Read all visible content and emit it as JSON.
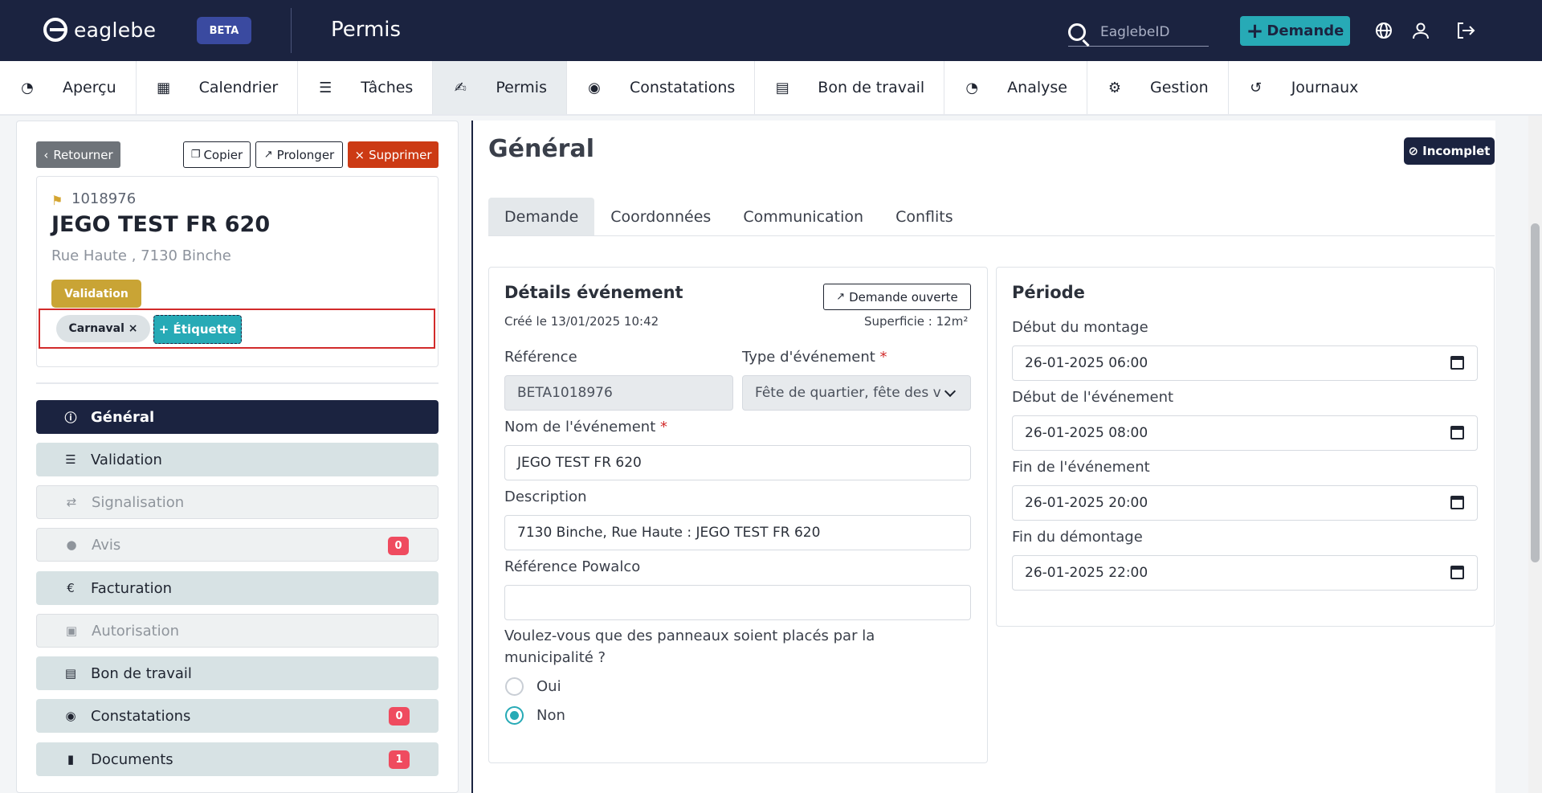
{
  "header": {
    "brand": "eaglebe",
    "beta_label": "BETA",
    "app_title": "Permis",
    "search_placeholder": "EaglebeID",
    "new_request_label": "Demande"
  },
  "nav": {
    "tabs": [
      {
        "label": "Aperçu",
        "icon": "gauge-icon"
      },
      {
        "label": "Calendrier",
        "icon": "calendar-icon"
      },
      {
        "label": "Tâches",
        "icon": "checklist-icon"
      },
      {
        "label": "Permis",
        "icon": "signature-icon",
        "active": true
      },
      {
        "label": "Constatations",
        "icon": "eye-icon"
      },
      {
        "label": "Bon de travail",
        "icon": "document-icon"
      },
      {
        "label": "Analyse",
        "icon": "gauge-icon"
      },
      {
        "label": "Gestion",
        "icon": "gears-icon"
      },
      {
        "label": "Journaux",
        "icon": "history-icon"
      }
    ]
  },
  "permit": {
    "back_label": "Retourner",
    "copy_label": "Copier",
    "extend_label": "Prolonger",
    "delete_label": "Supprimer",
    "id": "1018976",
    "name": "JEGO TEST FR 620",
    "address": "Rue Haute , 7130 Binche",
    "status": "Validation",
    "tags": [
      "Carnaval ×"
    ],
    "add_tag_label": "+ Étiquette"
  },
  "sidebar": {
    "items": [
      {
        "label": "Général",
        "icon": "info-icon",
        "style": "dark"
      },
      {
        "label": "Validation",
        "icon": "checklist-icon",
        "style": "teal"
      },
      {
        "label": "Signalisation",
        "icon": "signpost-icon",
        "style": "muted"
      },
      {
        "label": "Avis",
        "icon": "comment-icon",
        "style": "muted",
        "count": "0"
      },
      {
        "label": "Facturation",
        "icon": "euro-icon",
        "style": "teal"
      },
      {
        "label": "Autorisation",
        "icon": "file-check-icon",
        "style": "muted"
      },
      {
        "label": "Bon de travail",
        "icon": "document-icon",
        "style": "teal"
      },
      {
        "label": "Constatations",
        "icon": "eye-icon",
        "style": "teal",
        "count": "0"
      },
      {
        "label": "Documents",
        "icon": "file-icon",
        "style": "teal",
        "count": "1"
      }
    ]
  },
  "main": {
    "title": "Général",
    "status_badge": "Incomplet",
    "subtabs": [
      "Demande",
      "Coordonnées",
      "Communication",
      "Conflits"
    ],
    "details": {
      "title": "Détails événement",
      "open_request_label": "Demande ouverte",
      "created": "Créé le 13/01/2025 10:42",
      "area": "Superficie : 12m²",
      "reference_label": "Référence",
      "reference_value": "BETA1018976",
      "event_type_label": "Type d'événement",
      "event_type_value": "Fête de quartier, fête des v",
      "event_name_label": "Nom de l'événement",
      "event_name_value": "JEGO TEST FR 620",
      "description_label": "Description",
      "description_value": "7130 Binche, Rue Haute : JEGO TEST FR 620",
      "powalco_label": "Référence Powalco",
      "powalco_value": "",
      "signs_question_line1": "Voulez-vous que des panneaux soient placés par la",
      "signs_question_line2": "municipalité ?",
      "option_yes": "Oui",
      "option_no": "Non",
      "selected": "Non"
    },
    "period": {
      "title": "Période",
      "setup_start_label": "Début du montage",
      "setup_start_value": "26-01-2025 06:00",
      "event_start_label": "Début de l'événement",
      "event_start_value": "26-01-2025 08:00",
      "event_end_label": "Fin de l'événement",
      "event_end_value": "26-01-2025 20:00",
      "teardown_end_label": "Fin du démontage",
      "teardown_end_value": "26-01-2025 22:00"
    }
  },
  "colors": {
    "navy": "#1b2340",
    "teal": "#27aab6",
    "danger": "#cc3a14",
    "status_yellow": "#c9a435",
    "badge_red": "#ef4b5f"
  }
}
